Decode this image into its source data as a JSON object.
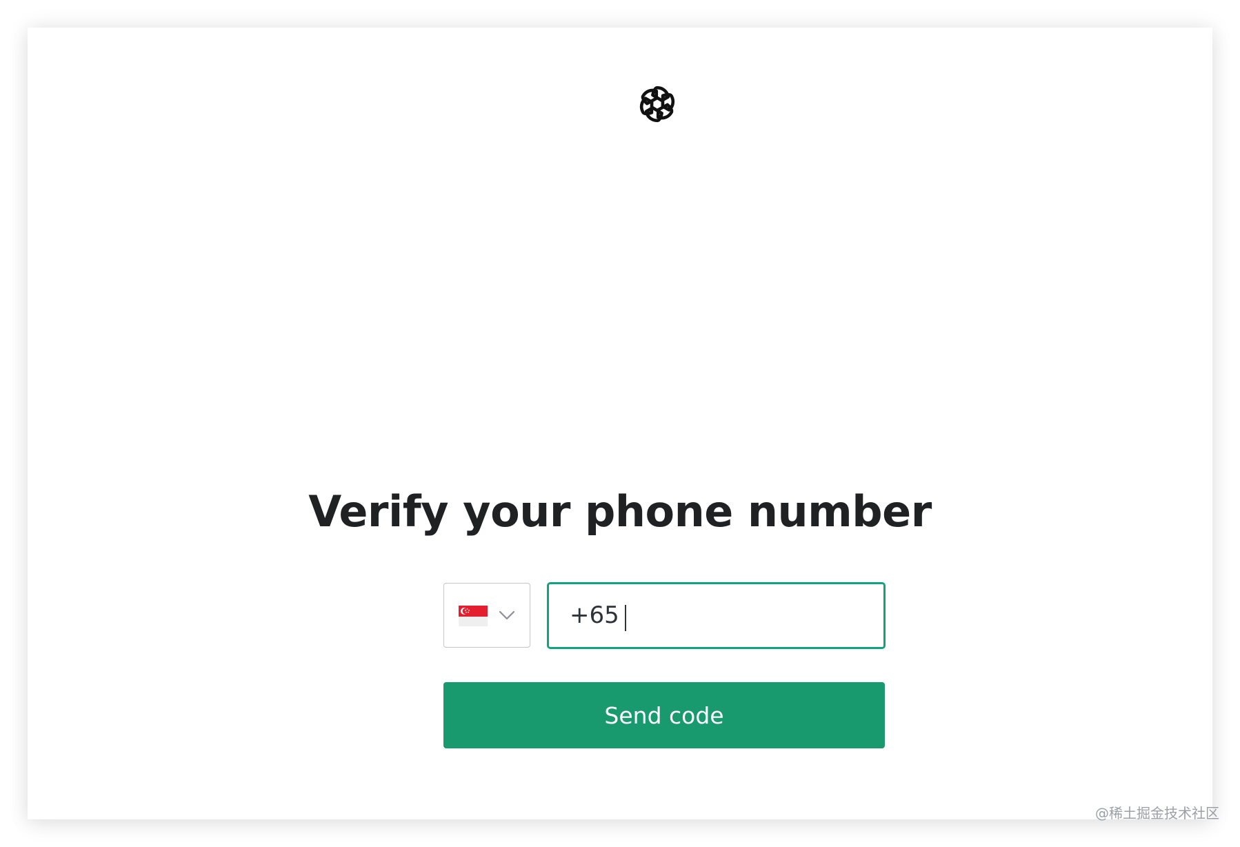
{
  "page": {
    "title": "Verify your phone number"
  },
  "logo": {
    "icon": "openai-logo-icon"
  },
  "country_select": {
    "selected_country": "Singapore",
    "flag_icon": "singapore-flag-icon",
    "dropdown_icon": "chevron-down-icon"
  },
  "phone_input": {
    "value": "+65 "
  },
  "send_button": {
    "label": "Send code"
  },
  "watermark": {
    "text": "@稀土掘金技术社区"
  },
  "colors": {
    "accent": "#10a37f",
    "button": "#19996e",
    "title": "#202123",
    "border": "#c2c5cc"
  }
}
